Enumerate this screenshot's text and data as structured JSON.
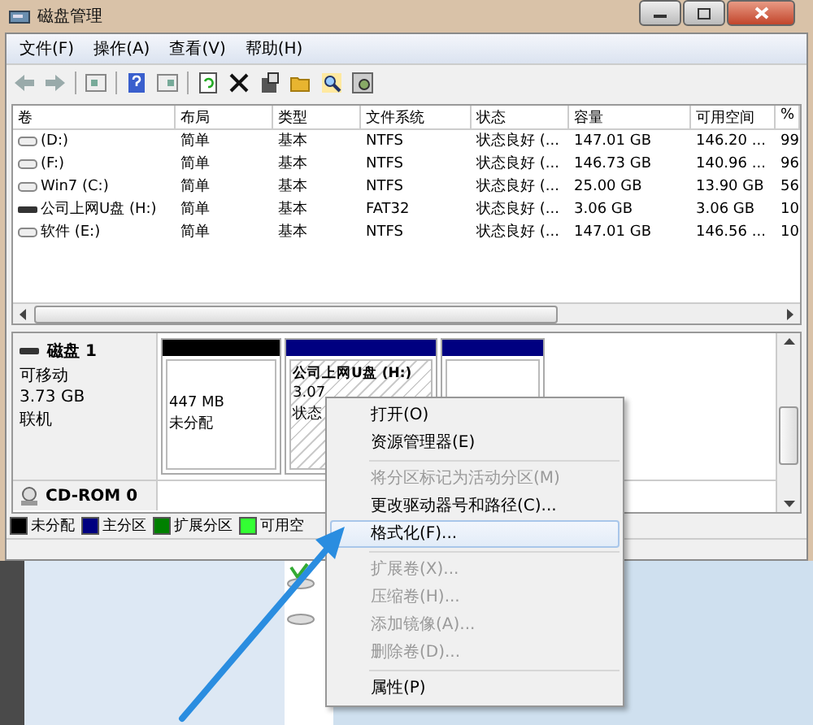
{
  "window": {
    "title": "磁盘管理"
  },
  "menu": [
    "文件(F)",
    "操作(A)",
    "查看(V)",
    "帮助(H)"
  ],
  "table": {
    "columns": [
      "卷",
      "布局",
      "类型",
      "文件系统",
      "状态",
      "容量",
      "可用空间",
      "%"
    ],
    "rows": [
      {
        "kind": "disk",
        "cells": [
          "(D:)",
          "简单",
          "基本",
          "NTFS",
          "状态良好 (...",
          "147.01 GB",
          "146.20 ...",
          "99"
        ]
      },
      {
        "kind": "disk",
        "cells": [
          "(F:)",
          "简单",
          "基本",
          "NTFS",
          "状态良好 (...",
          "146.73 GB",
          "140.96 ...",
          "96"
        ]
      },
      {
        "kind": "disk",
        "cells": [
          "Win7 (C:)",
          "简单",
          "基本",
          "NTFS",
          "状态良好 (...",
          "25.00 GB",
          "13.90 GB",
          "56"
        ]
      },
      {
        "kind": "usb",
        "cells": [
          "公司上网U盘 (H:)",
          "简单",
          "基本",
          "FAT32",
          "状态良好 (...",
          "3.06 GB",
          "3.06 GB",
          "10"
        ]
      },
      {
        "kind": "disk",
        "cells": [
          "软件 (E:)",
          "简单",
          "基本",
          "NTFS",
          "状态良好 (...",
          "147.01 GB",
          "146.56 ...",
          "10"
        ]
      }
    ]
  },
  "disk": {
    "name": "磁盘 1",
    "lines": [
      "可移动",
      "3.73 GB",
      "联机"
    ],
    "partitions": [
      {
        "kind": "unallocated",
        "lines": [
          "447 MB",
          "未分配"
        ]
      },
      {
        "kind": "primary",
        "title": "公司上网U盘 (H:)",
        "lines": [
          "3.07",
          "状态"
        ]
      },
      {
        "kind": "primary"
      }
    ]
  },
  "cdrom": {
    "name": "CD-ROM 0"
  },
  "legend": [
    {
      "label": "未分配",
      "color": "#000000"
    },
    {
      "label": "主分区",
      "color": "#000080"
    },
    {
      "label": "扩展分区",
      "color": "#008000"
    },
    {
      "label": "可用空",
      "color": "#33ff33"
    }
  ],
  "context_menu": [
    {
      "kind": "item",
      "label": "打开(O)",
      "disabled": false,
      "selected": false
    },
    {
      "kind": "item",
      "label": "资源管理器(E)",
      "disabled": false,
      "selected": false
    },
    {
      "kind": "separator"
    },
    {
      "kind": "item",
      "label": "将分区标记为活动分区(M)",
      "disabled": true,
      "selected": false
    },
    {
      "kind": "item",
      "label": "更改驱动器号和路径(C)...",
      "disabled": false,
      "selected": false
    },
    {
      "kind": "item",
      "label": "格式化(F)...",
      "disabled": false,
      "selected": true
    },
    {
      "kind": "separator"
    },
    {
      "kind": "item",
      "label": "扩展卷(X)...",
      "disabled": true,
      "selected": false
    },
    {
      "kind": "item",
      "label": "压缩卷(H)...",
      "disabled": true,
      "selected": false
    },
    {
      "kind": "item",
      "label": "添加镜像(A)...",
      "disabled": true,
      "selected": false
    },
    {
      "kind": "item",
      "label": "删除卷(D)...",
      "disabled": true,
      "selected": false
    },
    {
      "kind": "separator"
    },
    {
      "kind": "item",
      "label": "属性(P)",
      "disabled": false,
      "selected": false
    }
  ]
}
